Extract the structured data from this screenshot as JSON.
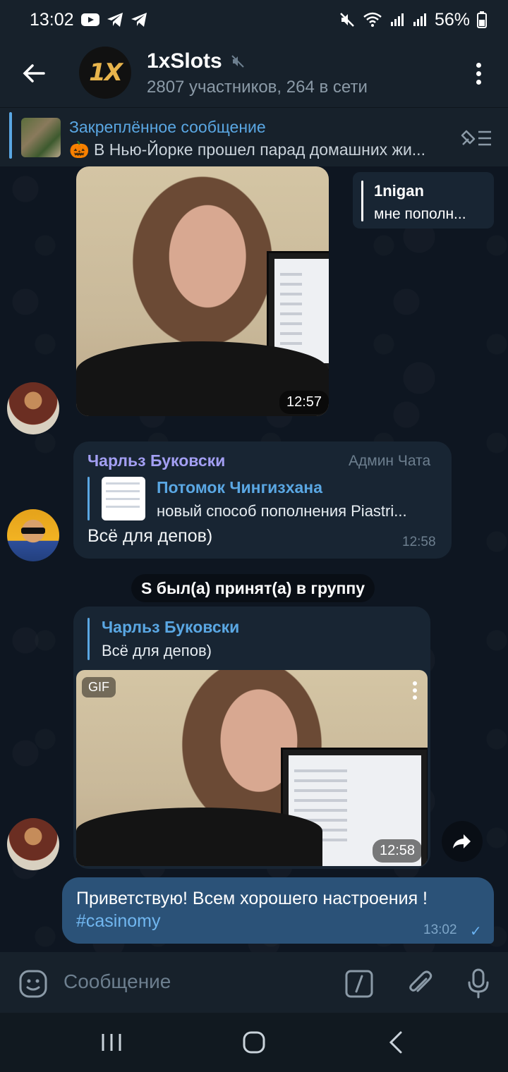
{
  "status_bar": {
    "time": "13:02",
    "battery": "56%"
  },
  "header": {
    "logo_text": "1X",
    "title": "1xSlots",
    "subtitle": "2807 участников, 264 в сети"
  },
  "pinned": {
    "title": "Закреплённое сообщение",
    "text": "🎃 В Нью-Йорке прошел парад домашних жи..."
  },
  "messages": {
    "photo1": {
      "time": "12:57",
      "reply": {
        "name": "1nigan",
        "text": "мне пополн..."
      }
    },
    "charles": {
      "sender": "Чарльз Буковски",
      "role": "Админ Чата",
      "quote_name": "Потомок Чингизхана",
      "quote_text": "новый способ пополнения  Piastri...",
      "text": "Всё для депов)",
      "time": "12:58"
    },
    "service": "S был(а) принят(а) в группу",
    "gif_msg": {
      "quote_name": "Чарльз Буковски",
      "quote_text": "Всё для депов)",
      "badge": "GIF",
      "time": "12:58"
    },
    "own": {
      "text": "Приветствую! Всем хорошего настроения !",
      "hashtag": "#casinomy",
      "time": "13:02",
      "check": "✓"
    }
  },
  "composer": {
    "placeholder": "Сообщение"
  }
}
